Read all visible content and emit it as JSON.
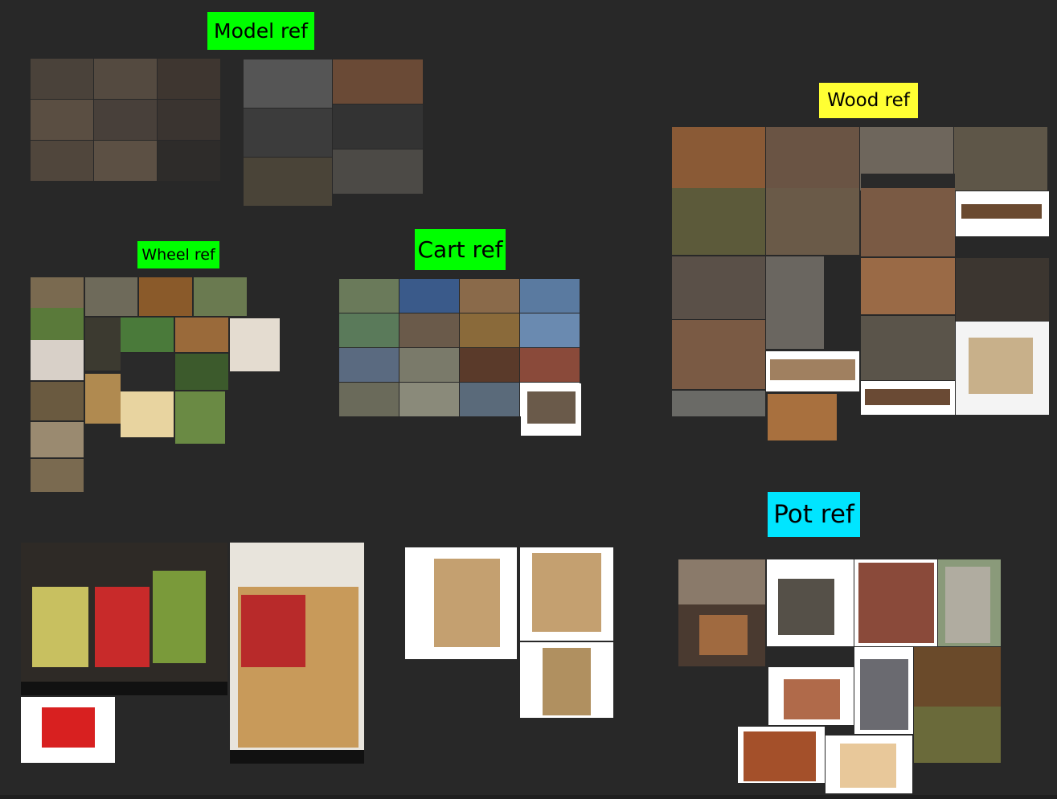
{
  "board": {
    "background": "#282828",
    "labels": {
      "model": {
        "text": "Model ref",
        "color": "#00ff00"
      },
      "wood": {
        "text": "Wood ref",
        "color": "#ffff33"
      },
      "wheel": {
        "text": "Wheel ref",
        "color": "#00ff00"
      },
      "cart": {
        "text": "Cart ref",
        "color": "#00ff00"
      },
      "pot": {
        "text": "Pot ref",
        "color": "#00e5ff"
      }
    }
  }
}
